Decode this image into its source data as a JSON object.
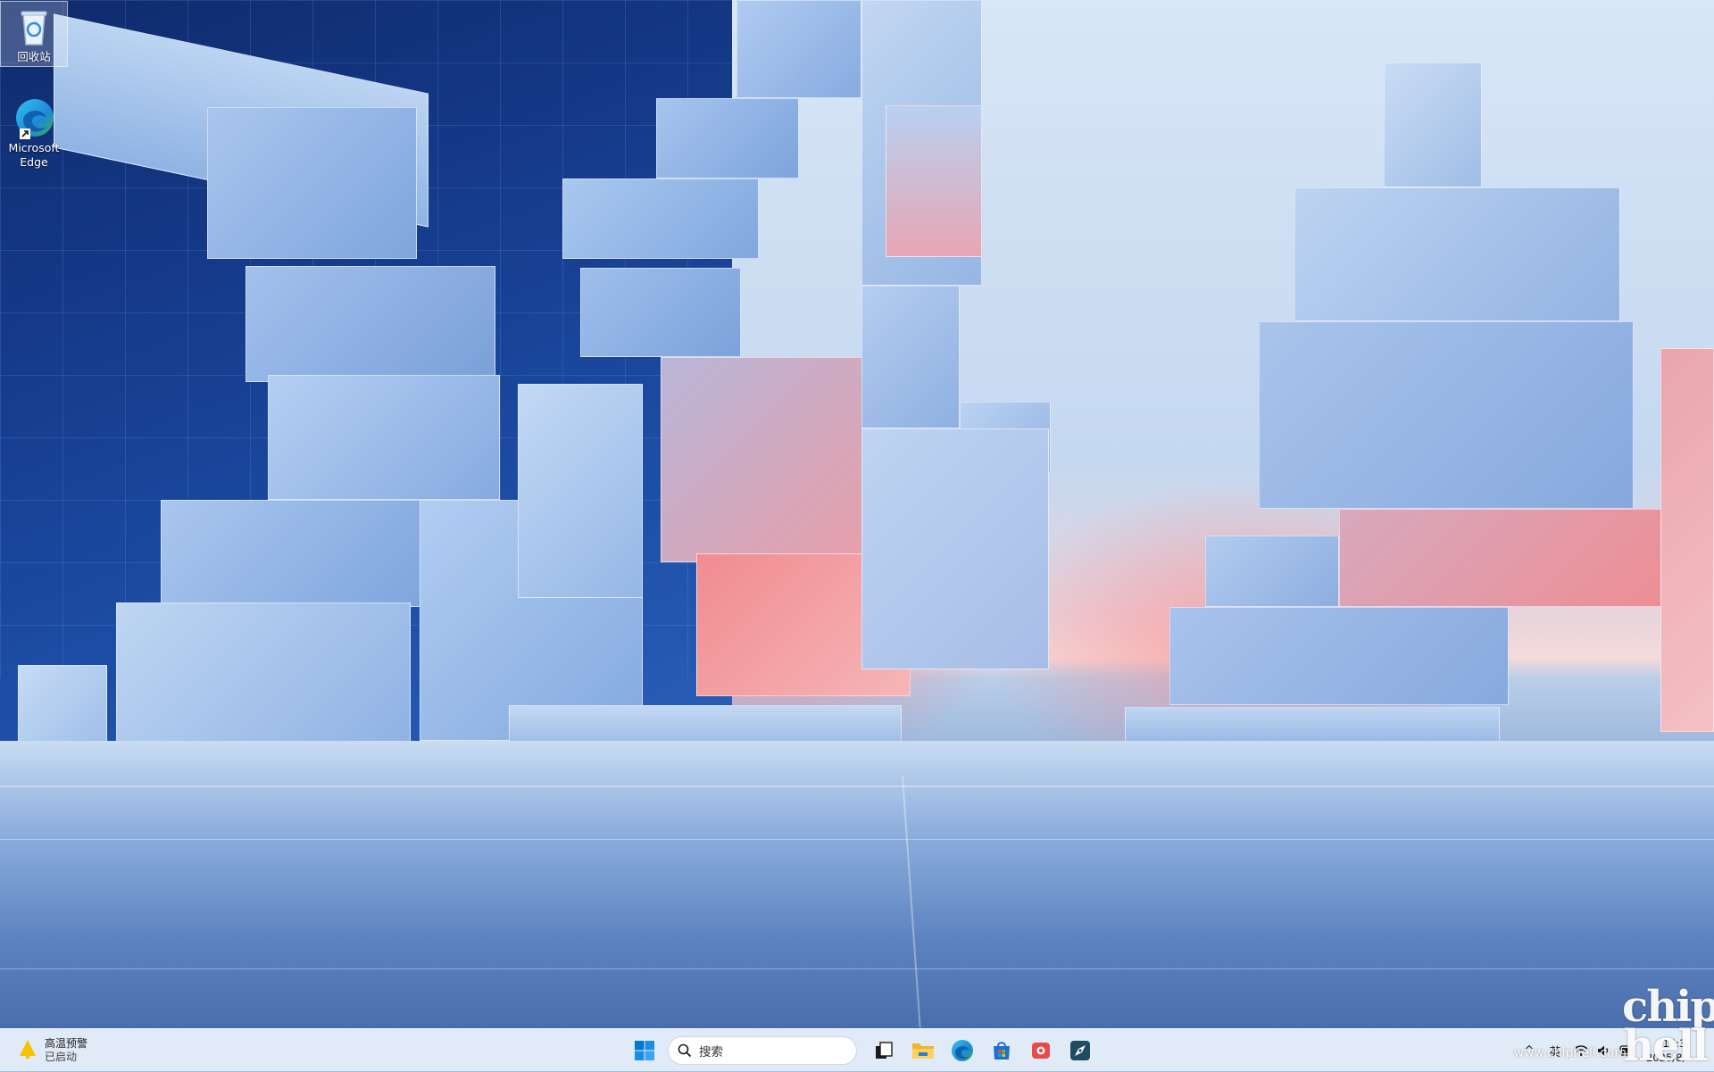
{
  "desktop": {
    "icons": [
      {
        "label": "回收站",
        "icon": "recycle-bin-icon",
        "selected": true
      },
      {
        "label": "Microsoft Edge",
        "icon": "edge-icon",
        "selected": false
      }
    ]
  },
  "taskbar": {
    "weather": {
      "title": "高温预警",
      "status": "已启动",
      "icon": "weather-warning-icon"
    },
    "start_icon": "windows-start-icon",
    "search": {
      "placeholder": "搜索",
      "icon": "search-icon"
    },
    "pinned_apps": [
      {
        "name": "task-view",
        "icon": "task-view-icon"
      },
      {
        "name": "file-explorer",
        "icon": "folder-icon"
      },
      {
        "name": "edge",
        "icon": "edge-icon"
      },
      {
        "name": "microsoft-store",
        "icon": "store-icon"
      },
      {
        "name": "recorder",
        "icon": "red-app-icon"
      },
      {
        "name": "app",
        "icon": "compass-app-icon"
      }
    ],
    "tray": {
      "chevron": "^",
      "ime": "英",
      "icons": [
        "wifi-icon",
        "volume-icon",
        "battery-icon"
      ],
      "clock_time": "16:3",
      "clock_date": "2025/8/"
    }
  },
  "watermark": {
    "logo": "chip hell",
    "url": "www.chiphell.com"
  },
  "colors": {
    "taskbar_bg": "#e6eef8",
    "accent_blue": "#0067c0"
  }
}
